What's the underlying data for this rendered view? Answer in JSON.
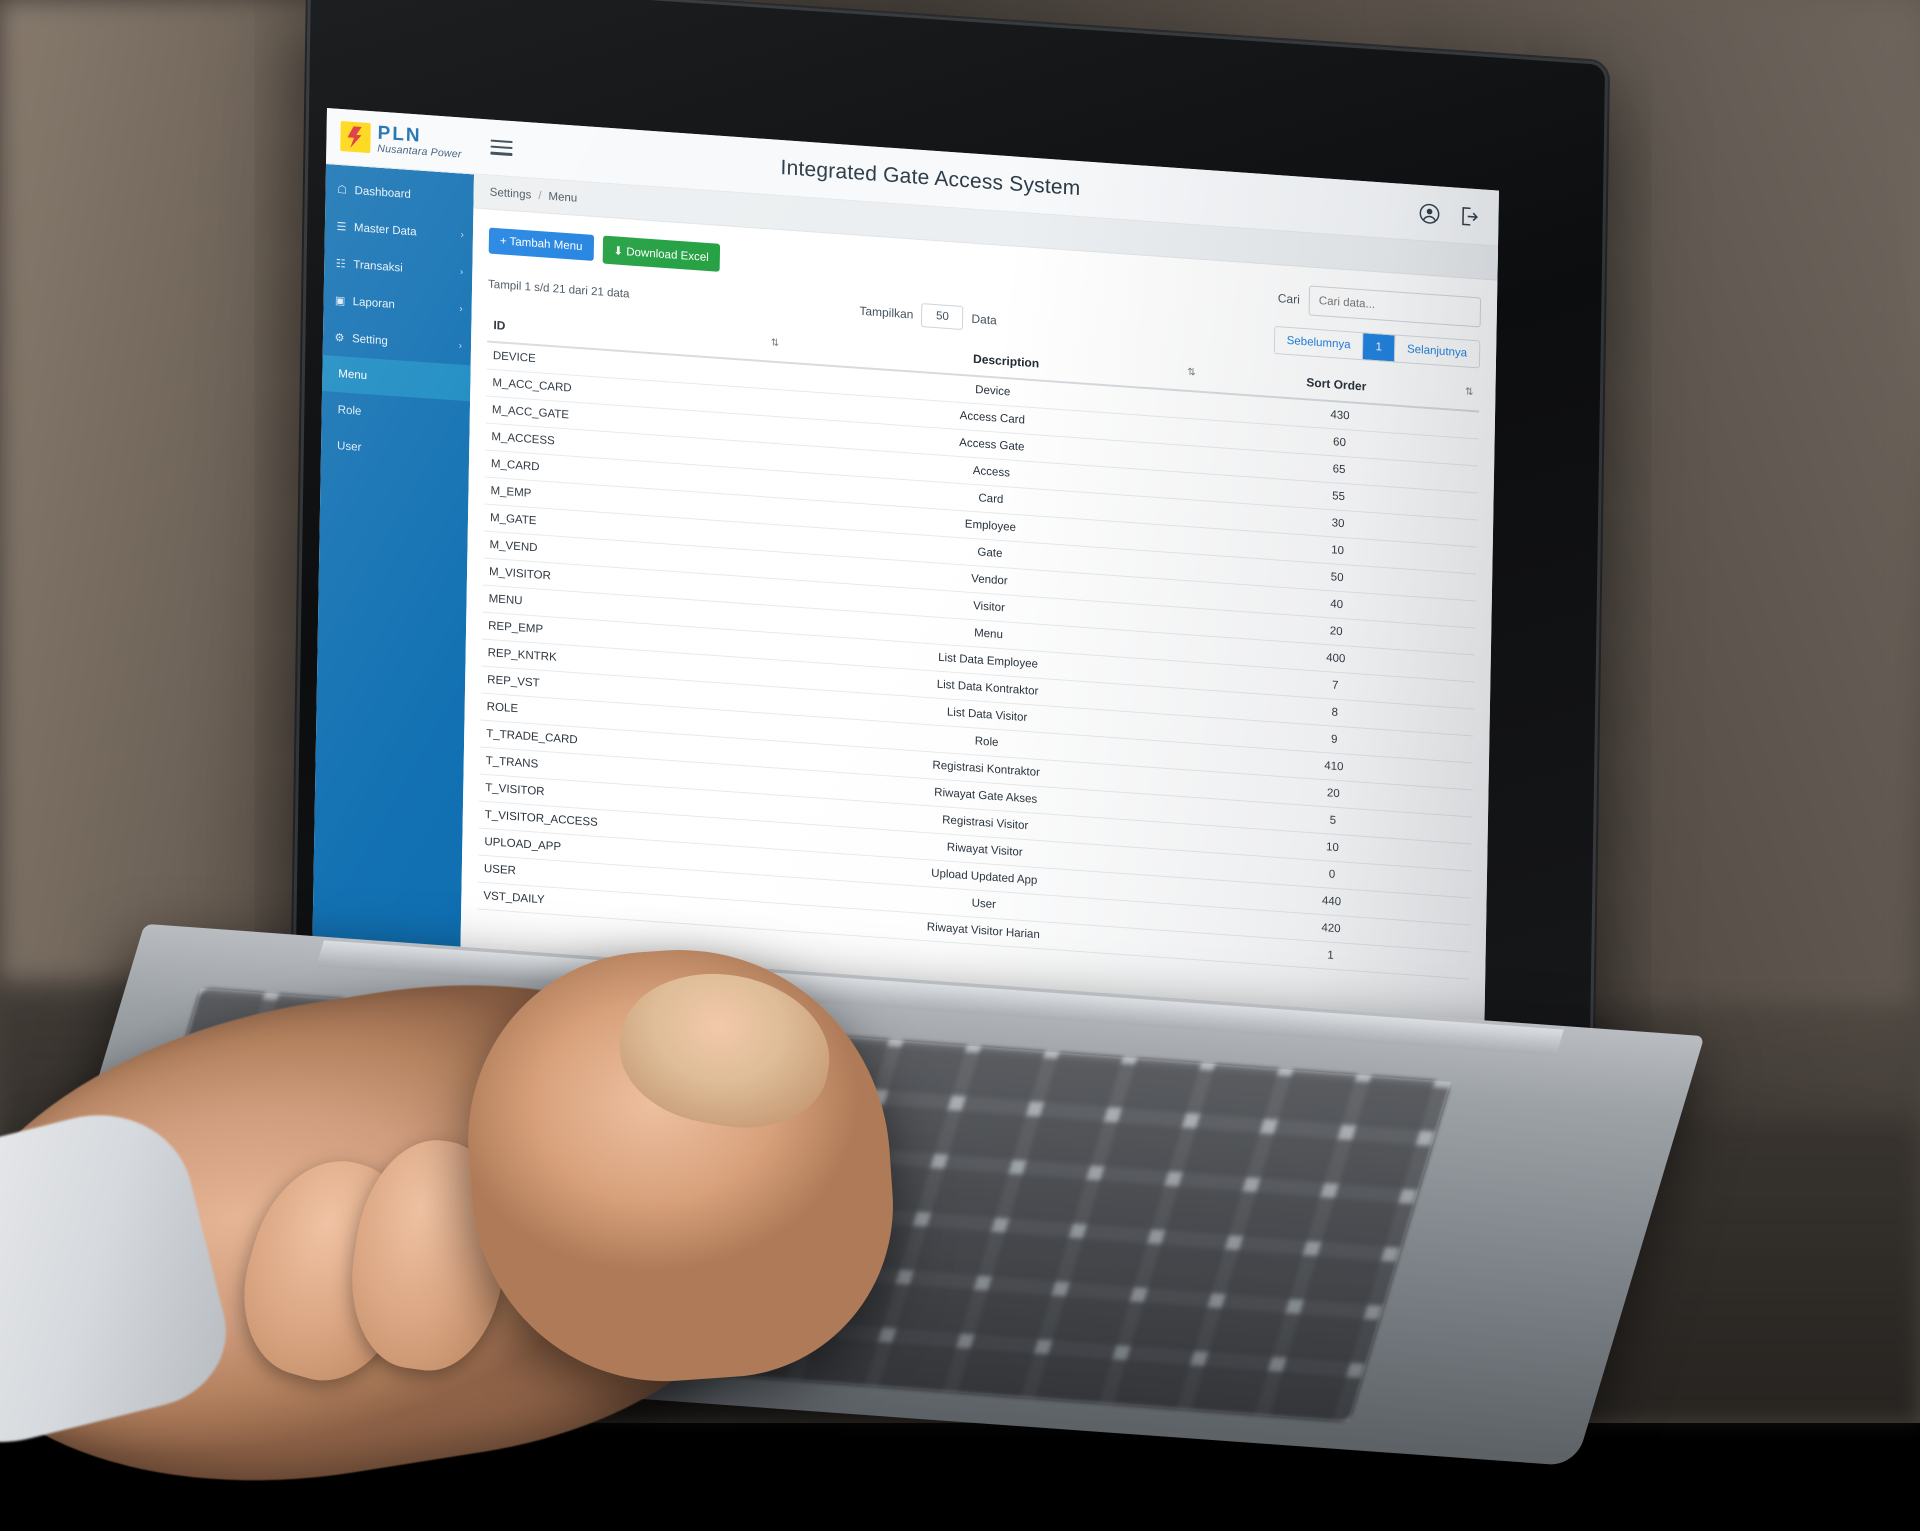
{
  "app": {
    "brand_top": "PLN",
    "brand_sub": "Nusantara Power",
    "title": "Integrated Gate Access System",
    "menu_icon": "hamburger-icon",
    "account_icon": "account-circle-icon",
    "logout_icon": "logout-icon"
  },
  "sidebar": {
    "items": [
      {
        "label": "Dashboard",
        "icon": "home-icon",
        "caret": "",
        "active": false
      },
      {
        "label": "Master Data",
        "icon": "list-icon",
        "caret": "›",
        "active": false
      },
      {
        "label": "Transaksi",
        "icon": "exchange-icon",
        "caret": "›",
        "active": false
      },
      {
        "label": "Laporan",
        "icon": "report-icon",
        "caret": "›",
        "active": false
      },
      {
        "label": "Setting",
        "icon": "gear-icon",
        "caret": "›",
        "active": false
      }
    ],
    "subitems": [
      {
        "label": "Menu",
        "active": true
      },
      {
        "label": "Role",
        "active": false
      },
      {
        "label": "User",
        "active": false
      }
    ]
  },
  "breadcrumb": {
    "parent": "Settings",
    "separator": "/",
    "current": "Menu"
  },
  "toolbar": {
    "add_label": "+ Tambah Menu",
    "export_label": "⬇ Download Excel",
    "search_label": "Cari",
    "search_placeholder": "Cari data...",
    "search_value": ""
  },
  "info": {
    "summary": "Tampil 1 s/d 21 dari 21 data",
    "length_label": "Tampilkan",
    "length_value": "50",
    "length_suffix": "Data"
  },
  "pagination": {
    "prev_label": "Sebelumnya",
    "current_page": "1",
    "next_label": "Selanjutnya"
  },
  "table": {
    "sort_icon": "⇅",
    "columns": [
      {
        "key": "id",
        "label": "ID"
      },
      {
        "key": "desc",
        "label": "Description"
      },
      {
        "key": "sort",
        "label": "Sort Order"
      }
    ],
    "rows": [
      {
        "id": "DEVICE",
        "desc": "Device",
        "sort": "430"
      },
      {
        "id": "M_ACC_CARD",
        "desc": "Access Card",
        "sort": "60"
      },
      {
        "id": "M_ACC_GATE",
        "desc": "Access Gate",
        "sort": "65"
      },
      {
        "id": "M_ACCESS",
        "desc": "Access",
        "sort": "55"
      },
      {
        "id": "M_CARD",
        "desc": "Card",
        "sort": "30"
      },
      {
        "id": "M_EMP",
        "desc": "Employee",
        "sort": "10"
      },
      {
        "id": "M_GATE",
        "desc": "Gate",
        "sort": "50"
      },
      {
        "id": "M_VEND",
        "desc": "Vendor",
        "sort": "40"
      },
      {
        "id": "M_VISITOR",
        "desc": "Visitor",
        "sort": "20"
      },
      {
        "id": "MENU",
        "desc": "Menu",
        "sort": "400"
      },
      {
        "id": "REP_EMP",
        "desc": "List Data Employee",
        "sort": "7"
      },
      {
        "id": "REP_KNTRK",
        "desc": "List Data Kontraktor",
        "sort": "8"
      },
      {
        "id": "REP_VST",
        "desc": "List Data Visitor",
        "sort": "9"
      },
      {
        "id": "ROLE",
        "desc": "Role",
        "sort": "410"
      },
      {
        "id": "T_TRADE_CARD",
        "desc": "Registrasi Kontraktor",
        "sort": "20"
      },
      {
        "id": "T_TRANS",
        "desc": "Riwayat Gate Akses",
        "sort": "5"
      },
      {
        "id": "T_VISITOR",
        "desc": "Registrasi Visitor",
        "sort": "10"
      },
      {
        "id": "T_VISITOR_ACCESS",
        "desc": "Riwayat Visitor",
        "sort": "0"
      },
      {
        "id": "UPLOAD_APP",
        "desc": "Upload Updated App",
        "sort": "440"
      },
      {
        "id": "USER",
        "desc": "User",
        "sort": "420"
      },
      {
        "id": "VST_DAILY",
        "desc": "Riwayat Visitor Harian",
        "sort": "1"
      }
    ]
  },
  "colors": {
    "sidebar": "#0a6cb0",
    "sidebar_active": "#1487c0",
    "primary": "#1a7fe0",
    "success": "#1f9e3e",
    "brand_blue": "#0a63a8",
    "brand_yellow": "#ffd400"
  }
}
